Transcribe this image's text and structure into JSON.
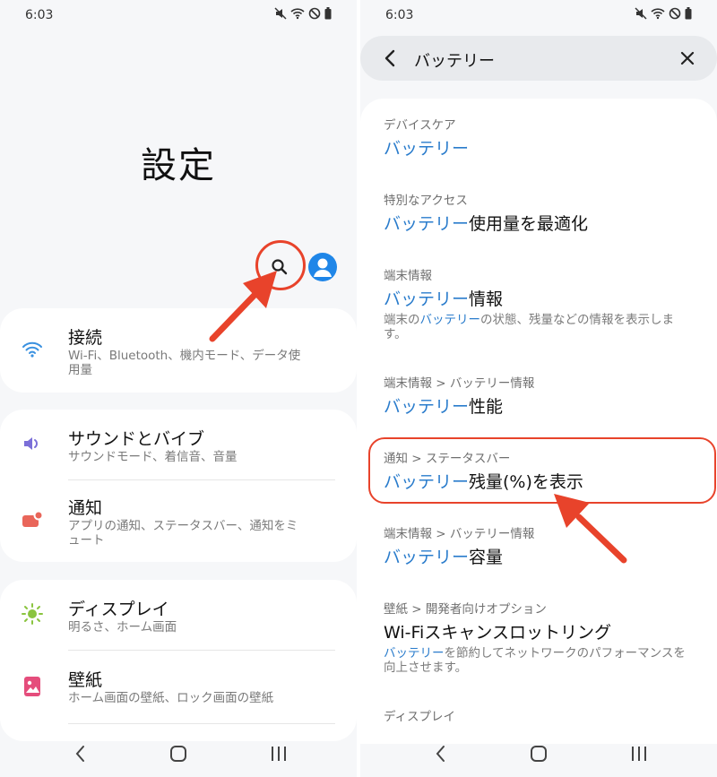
{
  "left": {
    "status_time": "6:03",
    "title": "設定",
    "items": [
      {
        "title": "接続",
        "subtitle": "Wi-Fi、Bluetooth、機内モード、データ使用量"
      },
      {
        "title": "サウンドとバイブ",
        "subtitle": "サウンドモード、着信音、音量"
      },
      {
        "title": "通知",
        "subtitle": "アプリの通知、ステータスバー、通知をミュート"
      },
      {
        "title": "ディスプレイ",
        "subtitle": "明るさ、ホーム画面"
      },
      {
        "title": "壁紙",
        "subtitle": "ホーム画面の壁紙、ロック画面の壁紙"
      }
    ]
  },
  "right": {
    "status_time": "6:03",
    "search_query": "バッテリー",
    "results": [
      {
        "path": "デバイスケア",
        "title_hl": "バッテリー",
        "title_rest": "",
        "desc_hl": "",
        "desc_rest": ""
      },
      {
        "path": "特別なアクセス",
        "title_hl": "バッテリー",
        "title_rest": "使用量を最適化",
        "desc_hl": "",
        "desc_rest": ""
      },
      {
        "path": "端末情報",
        "title_hl": "バッテリー",
        "title_rest": "情報",
        "desc_pre": "端末の",
        "desc_hl": "バッテリー",
        "desc_rest": "の状態、残量などの情報を表示します。"
      },
      {
        "path": "端末情報 > バッテリー情報",
        "title_hl": "バッテリー",
        "title_rest": "性能",
        "desc_hl": "",
        "desc_rest": ""
      },
      {
        "path": "通知 > ステータスバー",
        "title_hl": "バッテリー",
        "title_rest": "残量(%)を表示",
        "desc_hl": "",
        "desc_rest": ""
      },
      {
        "path": "端末情報 > バッテリー情報",
        "title_hl": "バッテリー",
        "title_rest": "容量",
        "desc_hl": "",
        "desc_rest": ""
      },
      {
        "path": "壁紙 > 開発者向けオプション",
        "title_hl": "",
        "title_rest": "Wi-Fiスキャンスロットリング",
        "desc_hl": "バッテリー",
        "desc_rest": "を節約してネットワークのパフォーマンスを向上させます。"
      },
      {
        "path": "ディスプレイ",
        "title_hl": "",
        "title_rest": "",
        "desc_hl": "",
        "desc_rest": ""
      }
    ]
  },
  "colors": {
    "accent_blue": "#2a7ccc",
    "annotation_red": "#e8432b",
    "avatar_blue": "#1f86e8"
  },
  "icons": [
    "search-icon",
    "profile-icon",
    "wifi-icon",
    "volume-icon",
    "notification-icon",
    "brightness-icon",
    "wallpaper-icon",
    "back-icon",
    "close-icon",
    "nav-back-icon",
    "nav-home-icon",
    "nav-recents-icon"
  ]
}
